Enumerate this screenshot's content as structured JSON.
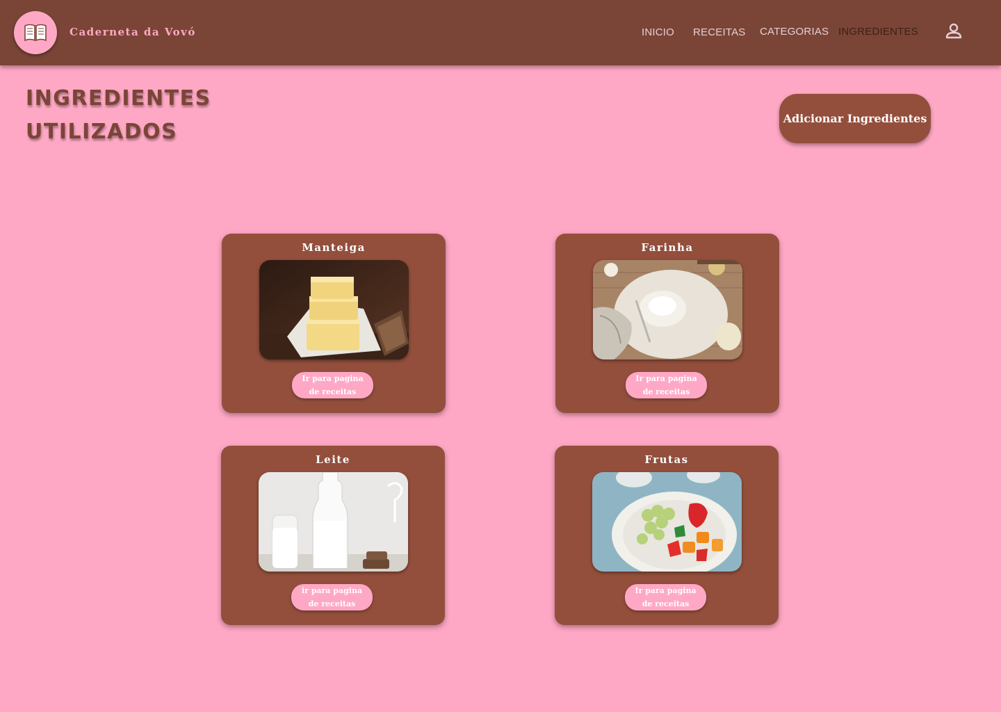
{
  "header": {
    "brand": "Caderneta da Vovó",
    "logo_icon": "open-book-icon",
    "nav": [
      {
        "label": "INICIO"
      },
      {
        "label": "RECEITAS"
      },
      {
        "label": "CATEGORIAS"
      },
      {
        "label": "INGREDIENTES"
      }
    ],
    "active_nav": "INGREDIENTES",
    "user_icon": "user-icon"
  },
  "page": {
    "title_line1": "INGREDIENTES",
    "title_line2": "UTILIZADOS",
    "add_button": "Adicionar Ingredientes"
  },
  "ingredients": [
    {
      "name": "Manteiga",
      "button": "Ir para pagina de receitas",
      "image": "butter-photo"
    },
    {
      "name": "Farinha",
      "button": "Ir para pagina de receitas",
      "image": "flour-photo"
    },
    {
      "name": "Leite",
      "button": "ir para pagina de receitas",
      "image": "milk-photo"
    },
    {
      "name": "Frutas",
      "button": "Ir para pagina de receitas",
      "image": "fruits-photo"
    }
  ],
  "colors": {
    "background": "#ffa8c5",
    "header": "#7a4536",
    "card": "#934f3c",
    "accent_pink": "#ffa8c5"
  }
}
